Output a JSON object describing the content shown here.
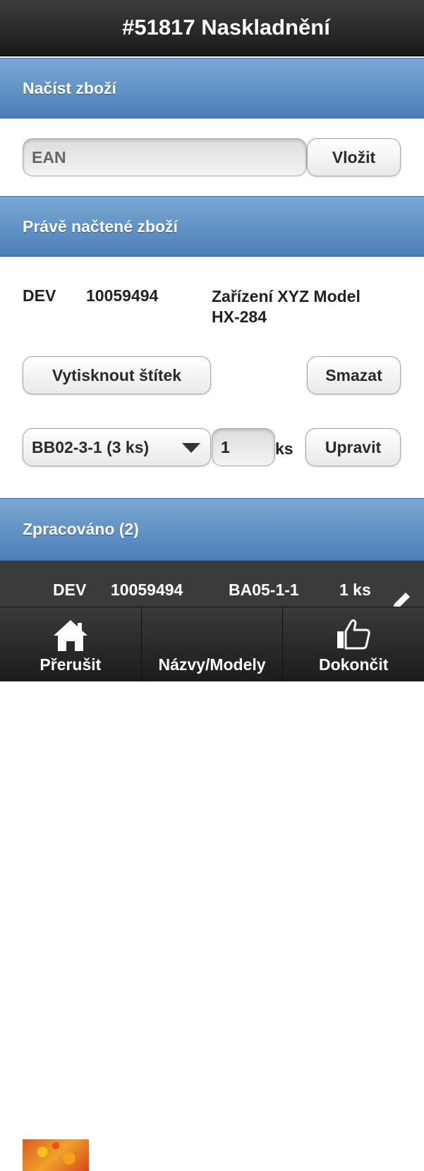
{
  "header": {
    "title": "#51817 Naskladnění"
  },
  "load_section": {
    "title": "Načíst zboží",
    "ean_placeholder": "EAN",
    "insert_label": "Vložit"
  },
  "current_section": {
    "title": "Právě načtené zboží",
    "item": {
      "type": "DEV",
      "code": "10059494",
      "name_line1": "Zařízení XYZ Model",
      "name_line2": "HX-284"
    },
    "print_label": "Vytisknout štítek",
    "delete_label": "Smazat",
    "location_select": "BB02-3-1 (3 ks)",
    "quantity": "1",
    "unit": "ks",
    "update_label": "Upravit"
  },
  "processed_section": {
    "title": "Zpracováno (2)",
    "row": {
      "type": "DEV",
      "code": "10059494",
      "location": "BA05-1-1",
      "qty": "1 ks"
    }
  },
  "navbar": {
    "items": [
      {
        "label": "Přerušit",
        "icon": "home-icon"
      },
      {
        "label": "Názvy/Modely",
        "icon": ""
      },
      {
        "label": "Dokončit",
        "icon": "thumbs-up-icon"
      }
    ]
  },
  "colors": {
    "header_bg": "#1a1a1a",
    "section_bar": "#4c7fb9",
    "dark_row": "#3b3b3b"
  }
}
